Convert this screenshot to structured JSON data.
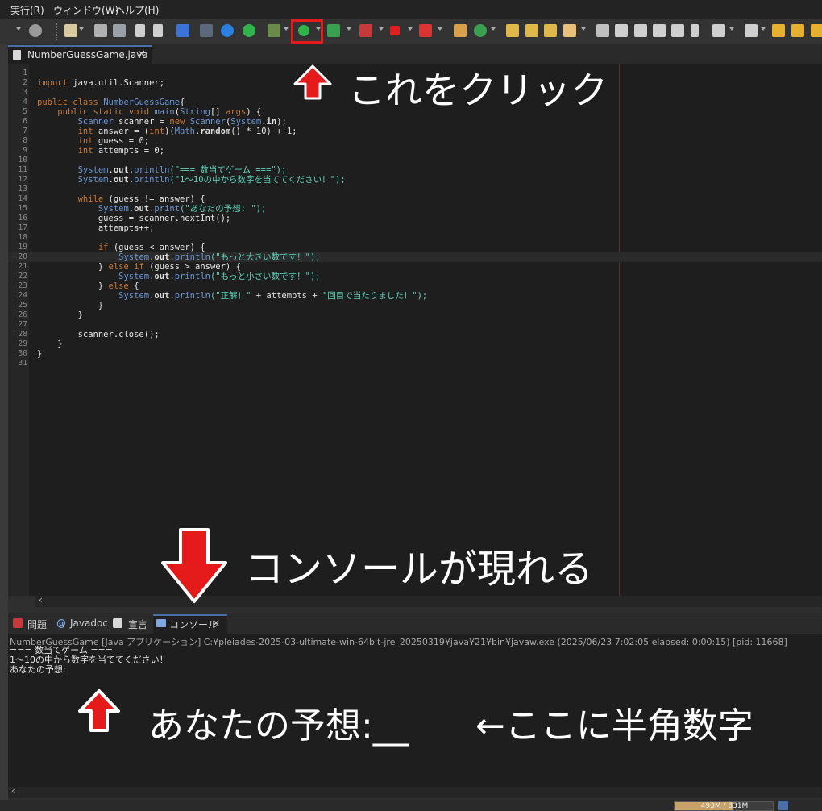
{
  "menu": [
    "実行(R)",
    "ウィンドウ(W)",
    "ヘルプ(H)"
  ],
  "editor": {
    "tab_label": "NumberGuessGame.java",
    "lines": [
      {
        "n": "1",
        "parts": []
      },
      {
        "n": "2",
        "parts": [
          [
            "kw",
            "import"
          ],
          [
            "pl",
            " java.util.Scanner;"
          ]
        ]
      },
      {
        "n": "3",
        "parts": []
      },
      {
        "n": "4",
        "parts": [
          [
            "kw",
            "public class "
          ],
          [
            "ty",
            "NumberGuessGame"
          ],
          [
            "pl",
            "{"
          ]
        ]
      },
      {
        "n": "5",
        "parts": [
          [
            "pl",
            "    "
          ],
          [
            "kw",
            "public static void "
          ],
          [
            "ty",
            "main"
          ],
          [
            "pl",
            "("
          ],
          [
            "ty",
            "String"
          ],
          [
            "pl",
            "[] "
          ],
          [
            "kw",
            "args"
          ],
          [
            "pl",
            ") {"
          ]
        ]
      },
      {
        "n": "6",
        "parts": [
          [
            "pl",
            "        "
          ],
          [
            "ty",
            "Scanner"
          ],
          [
            "pl",
            " scanner = "
          ],
          [
            "kw",
            "new "
          ],
          [
            "ty",
            "Scanner"
          ],
          [
            "pl",
            "("
          ],
          [
            "ty",
            "System"
          ],
          [
            "pl",
            "."
          ],
          [
            "fd",
            "in"
          ],
          [
            "pl",
            ");"
          ]
        ]
      },
      {
        "n": "7",
        "parts": [
          [
            "pl",
            "        "
          ],
          [
            "kw",
            "int"
          ],
          [
            "pl",
            " answer = ("
          ],
          [
            "kw",
            "int"
          ],
          [
            "pl",
            ")("
          ],
          [
            "ty",
            "Math"
          ],
          [
            "pl",
            "."
          ],
          [
            "fd",
            "random"
          ],
          [
            "pl",
            "() * 10) + 1;"
          ]
        ]
      },
      {
        "n": "8",
        "parts": [
          [
            "pl",
            "        "
          ],
          [
            "kw",
            "int"
          ],
          [
            "pl",
            " guess = 0;"
          ]
        ]
      },
      {
        "n": "9",
        "parts": [
          [
            "pl",
            "        "
          ],
          [
            "kw",
            "int"
          ],
          [
            "pl",
            " attempts = 0;"
          ]
        ]
      },
      {
        "n": "10",
        "parts": []
      },
      {
        "n": "11",
        "parts": [
          [
            "pl",
            "        "
          ],
          [
            "ty",
            "System"
          ],
          [
            "pl",
            "."
          ],
          [
            "fd",
            "out"
          ],
          [
            "pl",
            "."
          ],
          [
            "ty",
            "println"
          ],
          [
            "st",
            "(\"=== 数当てゲーム ===\");"
          ]
        ]
      },
      {
        "n": "12",
        "parts": [
          [
            "pl",
            "        "
          ],
          [
            "ty",
            "System"
          ],
          [
            "pl",
            "."
          ],
          [
            "fd",
            "out"
          ],
          [
            "pl",
            "."
          ],
          [
            "ty",
            "println"
          ],
          [
            "st",
            "(\"1～10の中から数字を当ててください！\");"
          ]
        ]
      },
      {
        "n": "13",
        "parts": []
      },
      {
        "n": "14",
        "parts": [
          [
            "pl",
            "        "
          ],
          [
            "kw",
            "while"
          ],
          [
            "pl",
            " (guess != answer) {"
          ]
        ]
      },
      {
        "n": "15",
        "parts": [
          [
            "pl",
            "            "
          ],
          [
            "ty",
            "System"
          ],
          [
            "pl",
            "."
          ],
          [
            "fd",
            "out"
          ],
          [
            "pl",
            "."
          ],
          [
            "ty",
            "print"
          ],
          [
            "st",
            "(\"あなたの予想: \");"
          ]
        ]
      },
      {
        "n": "16",
        "parts": [
          [
            "pl",
            "            guess = scanner.nextInt();"
          ]
        ]
      },
      {
        "n": "17",
        "parts": [
          [
            "pl",
            "            attempts++;"
          ]
        ]
      },
      {
        "n": "18",
        "parts": []
      },
      {
        "n": "19",
        "parts": [
          [
            "pl",
            "            "
          ],
          [
            "kw",
            "if"
          ],
          [
            "pl",
            " (guess < answer) {"
          ]
        ]
      },
      {
        "n": "20",
        "parts": [
          [
            "pl",
            "                "
          ],
          [
            "ty",
            "System"
          ],
          [
            "pl",
            "."
          ],
          [
            "fd",
            "out"
          ],
          [
            "pl",
            "."
          ],
          [
            "ty",
            "println"
          ],
          [
            "st",
            "(\"もっと大きい数です！\");"
          ]
        ],
        "hl": true
      },
      {
        "n": "21",
        "parts": [
          [
            "pl",
            "            } "
          ],
          [
            "kw",
            "else if"
          ],
          [
            "pl",
            " (guess > answer) {"
          ]
        ]
      },
      {
        "n": "22",
        "parts": [
          [
            "pl",
            "                "
          ],
          [
            "ty",
            "System"
          ],
          [
            "pl",
            "."
          ],
          [
            "fd",
            "out"
          ],
          [
            "pl",
            "."
          ],
          [
            "ty",
            "println"
          ],
          [
            "st",
            "(\"もっと小さい数です！\");"
          ]
        ]
      },
      {
        "n": "23",
        "parts": [
          [
            "pl",
            "            } "
          ],
          [
            "kw",
            "else"
          ],
          [
            "pl",
            " {"
          ]
        ]
      },
      {
        "n": "24",
        "parts": [
          [
            "pl",
            "                "
          ],
          [
            "ty",
            "System"
          ],
          [
            "pl",
            "."
          ],
          [
            "fd",
            "out"
          ],
          [
            "pl",
            "."
          ],
          [
            "ty",
            "println"
          ],
          [
            "st",
            "(\"正解！\" "
          ],
          [
            "pl",
            "+ attempts + "
          ],
          [
            "st",
            "\"回目で当たりました！\");"
          ]
        ]
      },
      {
        "n": "25",
        "parts": [
          [
            "pl",
            "            }"
          ]
        ]
      },
      {
        "n": "26",
        "parts": [
          [
            "pl",
            "        }"
          ]
        ]
      },
      {
        "n": "27",
        "parts": []
      },
      {
        "n": "28",
        "parts": [
          [
            "pl",
            "        scanner.close();"
          ]
        ]
      },
      {
        "n": "29",
        "parts": [
          [
            "pl",
            "    }"
          ]
        ]
      },
      {
        "n": "30",
        "parts": [
          [
            "pl",
            "}"
          ]
        ]
      },
      {
        "n": "31",
        "parts": []
      }
    ]
  },
  "console": {
    "tabs": [
      "問題",
      "Javadoc",
      "宣言",
      "コンソール"
    ],
    "process_line": "NumberGuessGame [Java アプリケーション] C:¥pleiades-2025-03-ultimate-win-64bit-jre_20250319¥java¥21¥bin¥javaw.exe  (2025/06/23 7:02:05 elapsed: 0:00:15) [pid: 11668]",
    "output": "=== 数当てゲーム ===\n1～10の中から数字を当ててください！\nあなたの予想:"
  },
  "annotations": {
    "click_here": "これをクリック",
    "console_appears": "コンソールが現れる",
    "prompt_example": "あなたの予想:__",
    "input_hint": "←ここに半角数字"
  },
  "colors": {
    "highlight_red": "#e51b1b",
    "run_green": "#2fb34a",
    "background": "#1e1e1e"
  },
  "status": {
    "heap_label": "493M / 831M",
    "heap_fraction": 0.59
  }
}
